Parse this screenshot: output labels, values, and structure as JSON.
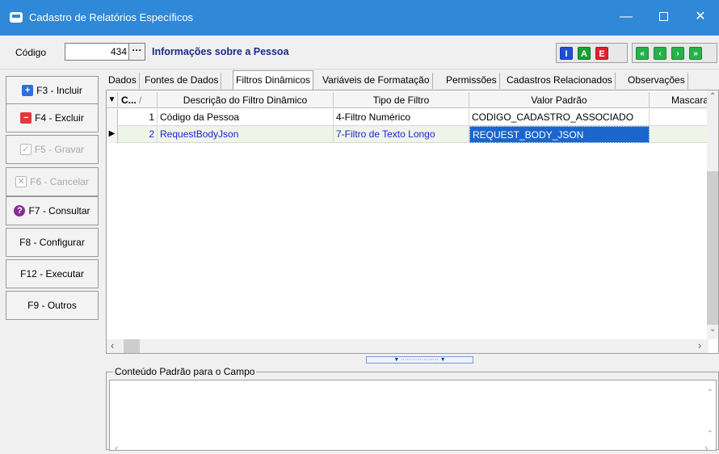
{
  "window": {
    "title": "Cadastro de Relatórios Específicos"
  },
  "header": {
    "codigo_label": "Código",
    "codigo_value": "434",
    "codigo_button": "···",
    "info_title": "Informações sobre a Pessoa",
    "badges": [
      "I",
      "A",
      "E"
    ],
    "nav": [
      "«",
      "‹",
      "›",
      "»"
    ]
  },
  "sidebar": {
    "buttons": [
      {
        "label": "F3 - Incluir",
        "icon": "plus-icon",
        "enabled": true
      },
      {
        "label": "F4 - Excluir",
        "icon": "minus-icon",
        "enabled": true
      },
      {
        "label": "F5 - Gravar",
        "icon": "check-icon",
        "enabled": false
      },
      {
        "label": "F6 - Cancelar",
        "icon": "x-box-icon",
        "enabled": false
      },
      {
        "label": "F7 - Consultar",
        "icon": "question-icon",
        "enabled": true
      },
      {
        "label": "F8 - Configurar",
        "enabled": true
      },
      {
        "label": "F12 - Executar",
        "enabled": true
      },
      {
        "label": "F9 - Outros",
        "enabled": true
      }
    ]
  },
  "tabs": [
    "Dados",
    "Fontes de Dados",
    "Filtros Dinâmicos",
    "Variáveis de Formatação",
    "Permissões",
    "Cadastros Relacionados",
    "Observações"
  ],
  "active_tab": "Filtros Dinâmicos",
  "grid": {
    "columns": [
      "C...",
      "Descrição do Filtro Dinâmico",
      "Tipo de Filtro",
      "Valor Padrão",
      "Mascara"
    ],
    "rows": [
      {
        "code": "1",
        "description": "Código da Pessoa",
        "type": "4-Filtro Numérico",
        "default": "CODIGO_CADASTRO_ASSOCIADO",
        "mask": ""
      },
      {
        "code": "2",
        "description": "RequestBodyJson",
        "type": "7-Filtro de Texto Longo",
        "default": "REQUEST_BODY_JSON",
        "mask": ""
      }
    ]
  },
  "groupbox": {
    "label": "Conteúdo Padrão para o Campo"
  },
  "colors": {
    "titlebar": "#2f88d8",
    "selection": "#1a66cc",
    "selected_row_text": "#2020d8"
  }
}
